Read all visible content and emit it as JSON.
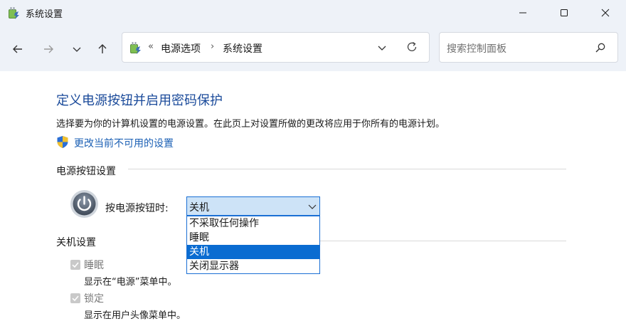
{
  "window": {
    "title": "系统设置"
  },
  "address": {
    "prefix": "«",
    "seg1": "电源选项",
    "separator": "›",
    "seg2": "系统设置"
  },
  "search": {
    "placeholder": "搜索控制面板"
  },
  "page": {
    "title": "定义电源按钮并启用密码保护",
    "description": "选择要为你的计算机设置的电源设置。在此页上对设置所做的更改将应用于你所有的电源计划。",
    "change_link": "更改当前不可用的设置"
  },
  "power_section": {
    "label": "电源按钮设置",
    "power_button_label": "按电源按钮时:",
    "selected": "关机",
    "options": [
      "不采取任何操作",
      "睡眠",
      "关机",
      "关闭显示器"
    ],
    "selected_index": 2
  },
  "shutdown_section": {
    "label": "关机设置",
    "items": [
      {
        "label": "睡眠",
        "desc": "显示在“电源”菜单中。",
        "checked": true
      },
      {
        "label": "锁定",
        "desc": "显示在用户头像菜单中。",
        "checked": true
      }
    ]
  },
  "icons": [
    "app-icon",
    "minimize-icon",
    "maximize-icon",
    "close-icon",
    "back-arrow-icon",
    "forward-arrow-icon",
    "recent-dropdown-icon",
    "up-arrow-icon",
    "address-dropdown-icon",
    "refresh-icon",
    "search-icon",
    "shield-icon",
    "power-icon",
    "chevron-down-icon",
    "checkmark-icon"
  ],
  "colors": {
    "title_blue": "#1a4a9a",
    "link_blue": "#1a5fb4",
    "select_highlight": "#0a6cd1",
    "chrome_bg": "#eef2f8"
  }
}
